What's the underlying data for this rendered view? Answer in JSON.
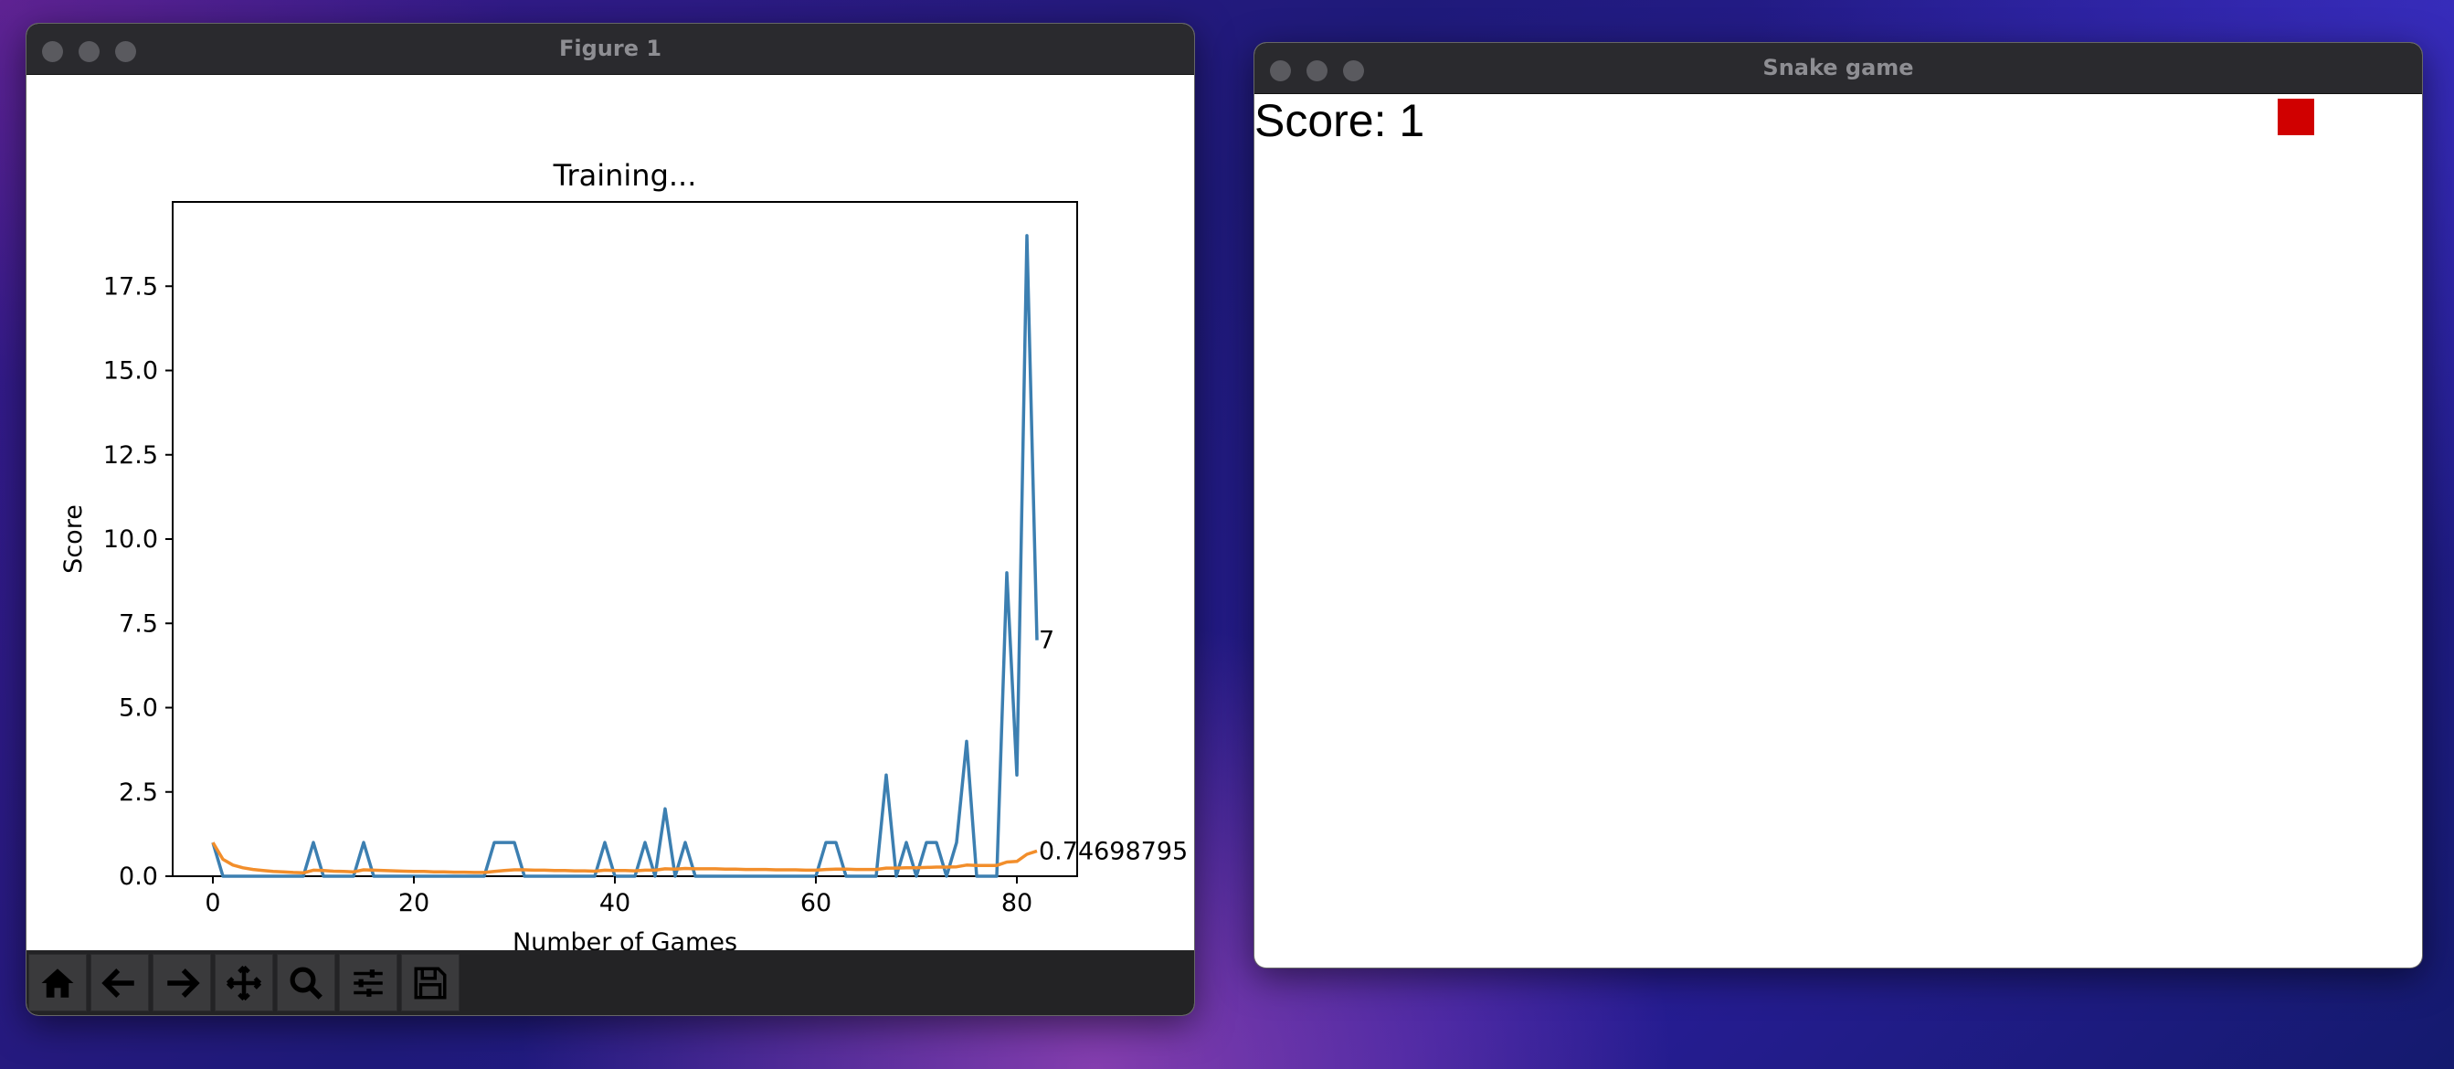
{
  "figure_window": {
    "title": "Figure 1",
    "toolbar": [
      "home-icon",
      "back-arrow-icon",
      "forward-arrow-icon",
      "pan-icon",
      "zoom-icon",
      "configure-subplots-icon",
      "save-icon"
    ]
  },
  "snake_window": {
    "title": "Snake game",
    "score_label": "Score: 1",
    "colors": {
      "food": "#d00000",
      "snake": "#0066ff"
    }
  },
  "chart_data": {
    "type": "line",
    "title": "Training...",
    "xlabel": "Number of Games",
    "ylabel": "Score",
    "xlim": [
      -4,
      86
    ],
    "ylim": [
      0,
      20
    ],
    "xticks": [
      "0",
      "20",
      "40",
      "60",
      "80"
    ],
    "yticks": [
      "0.0",
      "2.5",
      "5.0",
      "7.5",
      "10.0",
      "12.5",
      "15.0",
      "17.5"
    ],
    "grid": false,
    "series": [
      {
        "color": "#3c7fb1",
        "values": [
          1,
          0,
          0,
          0,
          0,
          0,
          0,
          0,
          0,
          0,
          1,
          0,
          0,
          0,
          0,
          1,
          0,
          0,
          0,
          0,
          0,
          0,
          0,
          0,
          0,
          0,
          0,
          0,
          1,
          1,
          1,
          0,
          0,
          0,
          0,
          0,
          0,
          0,
          0,
          1,
          0,
          0,
          0,
          1,
          0,
          2,
          0,
          1,
          0,
          0,
          0,
          0,
          0,
          0,
          0,
          0,
          0,
          0,
          0,
          0,
          0,
          1,
          1,
          0,
          0,
          0,
          0,
          3,
          0,
          1,
          0,
          1,
          1,
          0,
          1,
          4,
          0,
          0,
          0,
          9,
          3,
          19,
          7
        ],
        "end_label": "7"
      },
      {
        "color": "#f28e2b",
        "values": [
          1,
          0.5,
          0.33,
          0.25,
          0.2,
          0.17,
          0.14,
          0.13,
          0.11,
          0.1,
          0.18,
          0.17,
          0.15,
          0.14,
          0.13,
          0.19,
          0.18,
          0.17,
          0.16,
          0.15,
          0.14,
          0.14,
          0.13,
          0.13,
          0.12,
          0.12,
          0.11,
          0.11,
          0.14,
          0.17,
          0.19,
          0.19,
          0.18,
          0.18,
          0.17,
          0.17,
          0.16,
          0.16,
          0.15,
          0.18,
          0.17,
          0.17,
          0.16,
          0.18,
          0.18,
          0.22,
          0.21,
          0.23,
          0.22,
          0.22,
          0.22,
          0.21,
          0.21,
          0.2,
          0.2,
          0.2,
          0.19,
          0.19,
          0.19,
          0.18,
          0.18,
          0.2,
          0.21,
          0.21,
          0.2,
          0.2,
          0.2,
          0.24,
          0.24,
          0.25,
          0.25,
          0.26,
          0.27,
          0.27,
          0.28,
          0.33,
          0.32,
          0.32,
          0.32,
          0.42,
          0.44,
          0.65,
          0.74698795
        ],
        "end_label": "0.74698795"
      }
    ]
  }
}
